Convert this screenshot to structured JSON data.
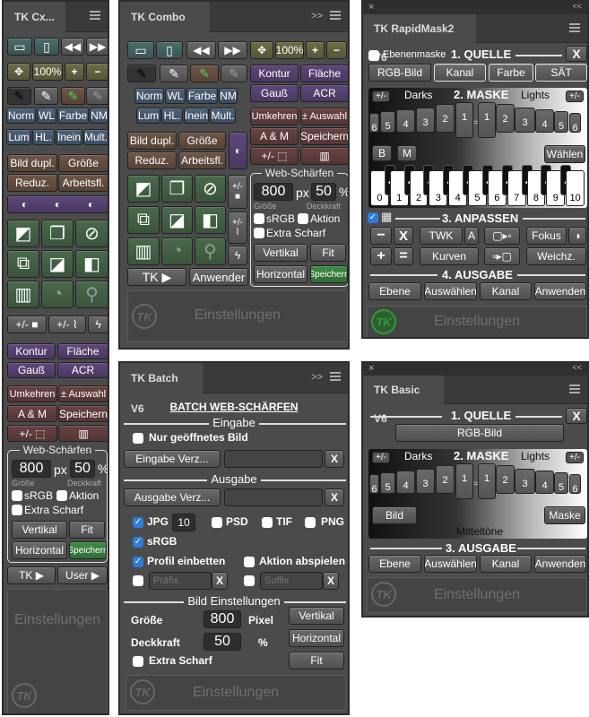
{
  "tools": {
    "zoom": "100%",
    "blend": [
      "Norm",
      "WL",
      "Farbe",
      "NM",
      "Lum",
      "HL.",
      "Inein",
      "Mult."
    ],
    "doc": [
      "Bild dupl.",
      "Größe",
      "Reduz.",
      "Arbeitsfl."
    ],
    "pm": "+/-",
    "filters": [
      "Kontur",
      "Fläche",
      "Gauß",
      "ACR"
    ],
    "sel": [
      "Umkehren",
      "± Auswahl",
      "A & M",
      "Speichern"
    ],
    "settings": "Einstellungen",
    "logo": "TK"
  },
  "web": {
    "legend": "Web-Schärfen",
    "size": "800",
    "px": "px",
    "opacity": "50",
    "pct": "%",
    "size_label": "Größe",
    "opacity_label": "Deckkraft",
    "srgb": "sRGB",
    "aktion": "Aktion",
    "extra": "Extra Scharf",
    "vertikal": "Vertikal",
    "fit": "Fit",
    "horizontal": "Horizontal",
    "save": "Speichern"
  },
  "cx": {
    "title": "TK Cx...",
    "tk": "TK ▶",
    "user": "User ▶"
  },
  "combo": {
    "title": "TK Combo V6",
    "tk": "TK ▶",
    "user": "Anwender",
    "collapse": ">>"
  },
  "rapid": {
    "title": "TK RapidMask2 V6",
    "close": "×",
    "expand": "<<",
    "layer_mask": "Ebenenmaske",
    "quelle": "1. QUELLE",
    "x": "X",
    "sources": [
      "RGB-Bild",
      "Kanal",
      "Farbe",
      "SÄT"
    ],
    "maske": "2. MASKE",
    "darks": "Darks",
    "lights": "Lights",
    "pm": "+/-",
    "b": "B",
    "m": "M",
    "choose": "Wählen",
    "anpassen": "3. ANPASSEN",
    "adjust": [
      "−",
      "X",
      "TWK",
      "A",
      "Fokus",
      "+",
      "=",
      "Kurven",
      "Weichz."
    ],
    "ausgabe": "4. AUSGABE",
    "outputs": [
      "Ebene",
      "Auswählen",
      "Kanal",
      "Anwenden"
    ],
    "anpassen_checked": true
  },
  "mask_tabs": {
    "left": [
      "6",
      "5",
      "4",
      "3",
      "2",
      "1"
    ],
    "right": [
      "1",
      "2",
      "3",
      "4",
      "5",
      "6"
    ],
    "mid": "="
  },
  "zones": [
    "0",
    "1",
    "2",
    "3",
    "4",
    "5",
    "6",
    "7",
    "8",
    "9",
    "10"
  ],
  "batch": {
    "title": "TK Batch V6",
    "collapse": ">>",
    "heading": "BATCH WEB-SCHÄRFEN",
    "eingabe": "Eingabe",
    "only_open": "Nur geöffnetes Bild",
    "in_dir": "Eingabe Verz...",
    "x": "X",
    "ausgabe": "Ausgabe",
    "out_dir": "Ausgabe Verz...",
    "jpg": "JPG",
    "quality": "10",
    "psd": "PSD",
    "tif": "TIF",
    "png": "PNG",
    "srgb": "sRGB",
    "profile": "Profil einbetten",
    "action": "Aktion abspielen",
    "prefix_placeholder": "Präfix",
    "suffix_placeholder": "Suffix",
    "bild": "Bild Einstellungen",
    "size_label": "Größe",
    "size": "800",
    "pixel": "Pixel",
    "opacity_label": "Deckkraft",
    "opacity": "50",
    "pct": "%",
    "extra": "Extra Scharf",
    "vertikal": "Vertikal",
    "horizontal": "Horizontal",
    "fit": "Fit",
    "checks": {
      "jpg": true,
      "srgb": true,
      "profile": true,
      "only_open": false,
      "psd": false,
      "tif": false,
      "png": false
    }
  },
  "basic": {
    "title": "TK Basic V6",
    "close": "×",
    "expand": "<<",
    "quelle": "1. QUELLE",
    "x": "X",
    "source": "RGB-Bild",
    "maske": "2. MASKE",
    "darks": "Darks",
    "lights": "Lights",
    "pm": "+/-",
    "bild": "Bild",
    "maske_btn": "Maske",
    "mid": "Mitteltöne",
    "ausgabe": "3. AUSGABE",
    "outputs": [
      "Ebene",
      "Auswählen",
      "Kanal",
      "Anwenden"
    ]
  },
  "colors": {
    "file": "#3d5a57",
    "zoom": "#5b5b3a",
    "blend": "#3c4f66",
    "doc": "#5d4a40",
    "filter": "#513d63",
    "layer": "#3f5a42",
    "select": "#5a3a3a",
    "accent_green": "#2f9a3a",
    "checkbox": "#2f7bd8"
  }
}
